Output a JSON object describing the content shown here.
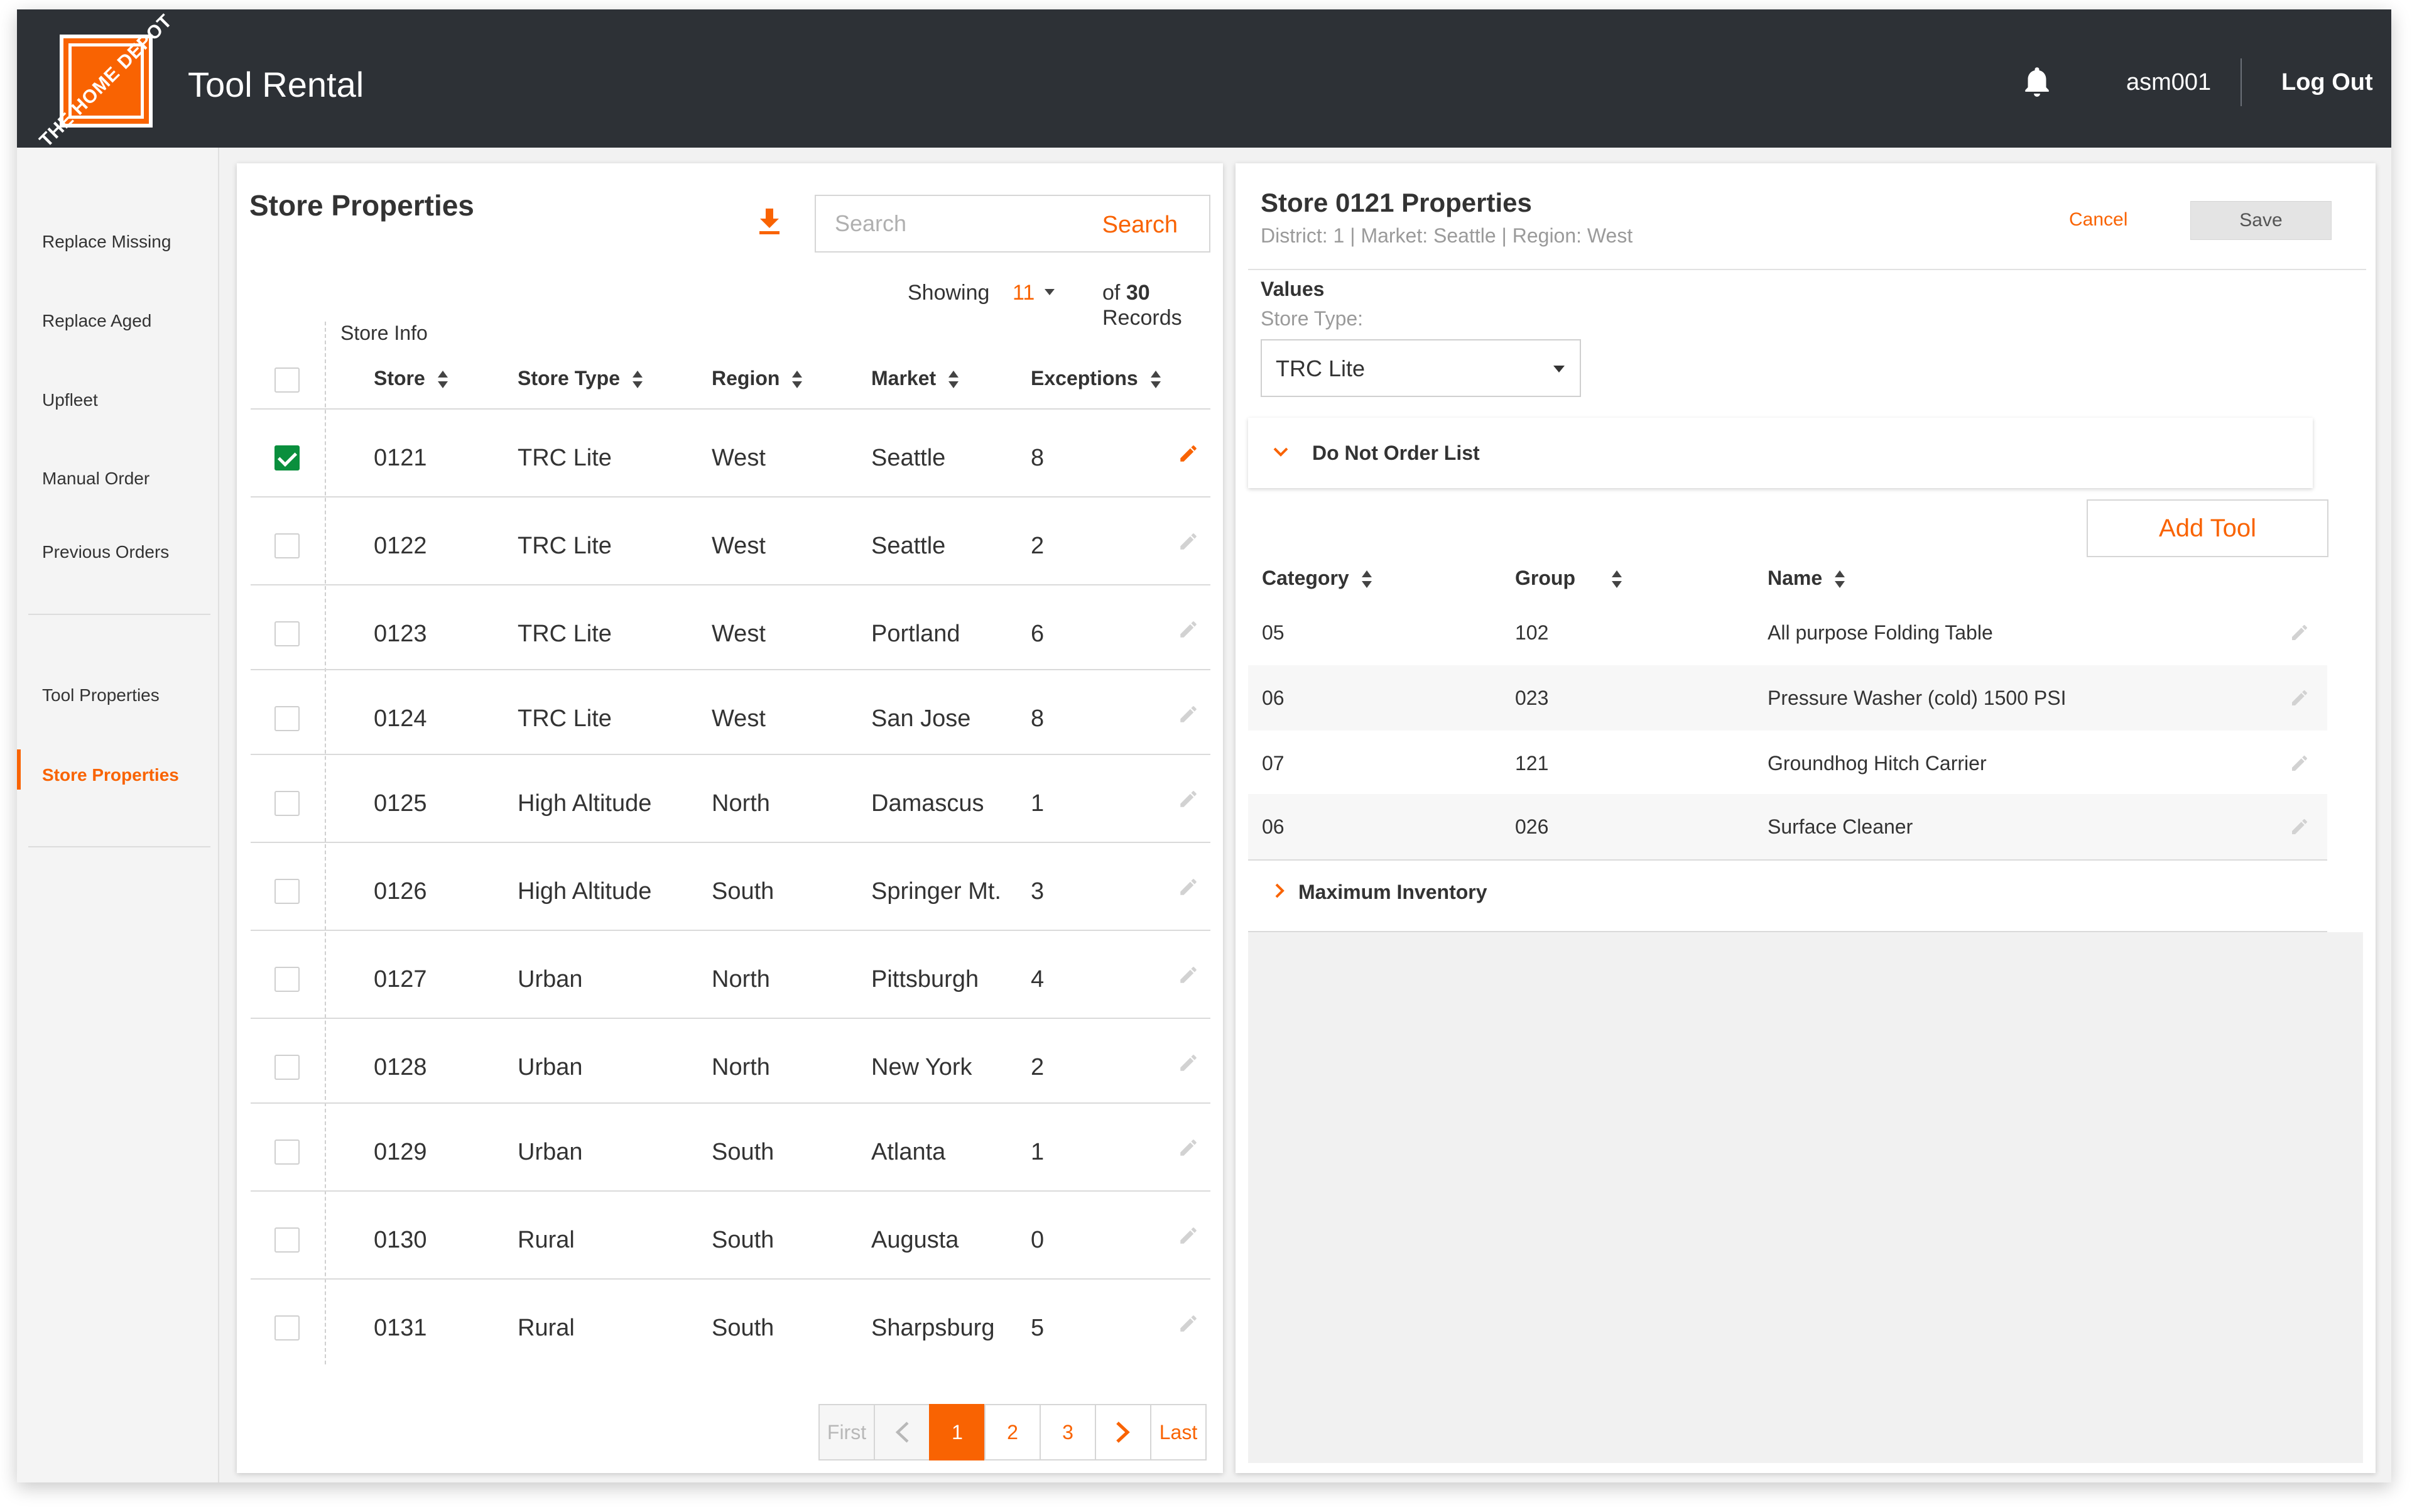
{
  "header": {
    "logo_text": "THE HOME DEPOT",
    "app_title": "Tool Rental",
    "bell_icon": "bell-icon",
    "username": "asm001",
    "logout_label": "Log Out"
  },
  "sidebar": {
    "items": [
      {
        "label": "Replace Missing"
      },
      {
        "label": "Replace Aged"
      },
      {
        "label": "Upfleet"
      },
      {
        "label": "Manual Order"
      },
      {
        "label": "Previous Orders"
      },
      {
        "label": "Tool Properties"
      },
      {
        "label": "Store Properties",
        "active": true
      }
    ]
  },
  "store_list": {
    "title": "Store Properties",
    "download_icon": "download-icon",
    "search_placeholder": "Search",
    "search_button": "Search",
    "showing_label": "Showing",
    "per_page": "11",
    "of_label": "of",
    "total_records": "30",
    "records_label": "Records",
    "group_header": "Store Info",
    "columns": [
      "Store",
      "Store Type",
      "Region",
      "Market",
      "Exceptions"
    ],
    "rows": [
      {
        "store": "0121",
        "type": "TRC Lite",
        "region": "West",
        "market": "Seattle",
        "exceptions": "8",
        "checked": true
      },
      {
        "store": "0122",
        "type": "TRC Lite",
        "region": "West",
        "market": "Seattle",
        "exceptions": "2",
        "checked": false
      },
      {
        "store": "0123",
        "type": "TRC Lite",
        "region": "West",
        "market": "Portland",
        "exceptions": "6",
        "checked": false
      },
      {
        "store": "0124",
        "type": "TRC Lite",
        "region": "West",
        "market": "San Jose",
        "exceptions": "8",
        "checked": false
      },
      {
        "store": "0125",
        "type": "High Altitude",
        "region": "North",
        "market": "Damascus",
        "exceptions": "1",
        "checked": false
      },
      {
        "store": "0126",
        "type": "High Altitude",
        "region": "South",
        "market": "Springer Mt.",
        "exceptions": "3",
        "checked": false
      },
      {
        "store": "0127",
        "type": "Urban",
        "region": "North",
        "market": "Pittsburgh",
        "exceptions": "4",
        "checked": false
      },
      {
        "store": "0128",
        "type": "Urban",
        "region": "North",
        "market": "New York",
        "exceptions": "2",
        "checked": false
      },
      {
        "store": "0129",
        "type": "Urban",
        "region": "South",
        "market": "Atlanta",
        "exceptions": "1",
        "checked": false
      },
      {
        "store": "0130",
        "type": "Rural",
        "region": "South",
        "market": "Augusta",
        "exceptions": "0",
        "checked": false
      },
      {
        "store": "0131",
        "type": "Rural",
        "region": "South",
        "market": "Sharpsburg",
        "exceptions": "5",
        "checked": false
      }
    ],
    "pagination": {
      "first": "First",
      "pages": [
        "1",
        "2",
        "3"
      ],
      "current": "1",
      "last": "Last"
    }
  },
  "store_detail": {
    "title": "Store 0121 Properties",
    "subtitle": "District: 1 | Market: Seattle | Region: West",
    "cancel_label": "Cancel",
    "save_label": "Save",
    "values_label": "Values",
    "store_type_label": "Store Type:",
    "store_type_value": "TRC Lite",
    "do_not_order_label": "Do Not Order List",
    "add_tool_label": "Add Tool",
    "tool_columns": [
      "Category",
      "Group",
      "Name"
    ],
    "tools": [
      {
        "category": "05",
        "group": "102",
        "name": "All purpose Folding Table"
      },
      {
        "category": "06",
        "group": "023",
        "name": "Pressure Washer (cold) 1500 PSI"
      },
      {
        "category": "07",
        "group": "121",
        "name": "Groundhog Hitch Carrier"
      },
      {
        "category": "06",
        "group": "026",
        "name": "Surface Cleaner"
      }
    ],
    "max_inventory_label": "Maximum Inventory"
  },
  "colors": {
    "accent": "#f96302",
    "topbar": "#2d3136",
    "check": "#0a8f3d"
  }
}
